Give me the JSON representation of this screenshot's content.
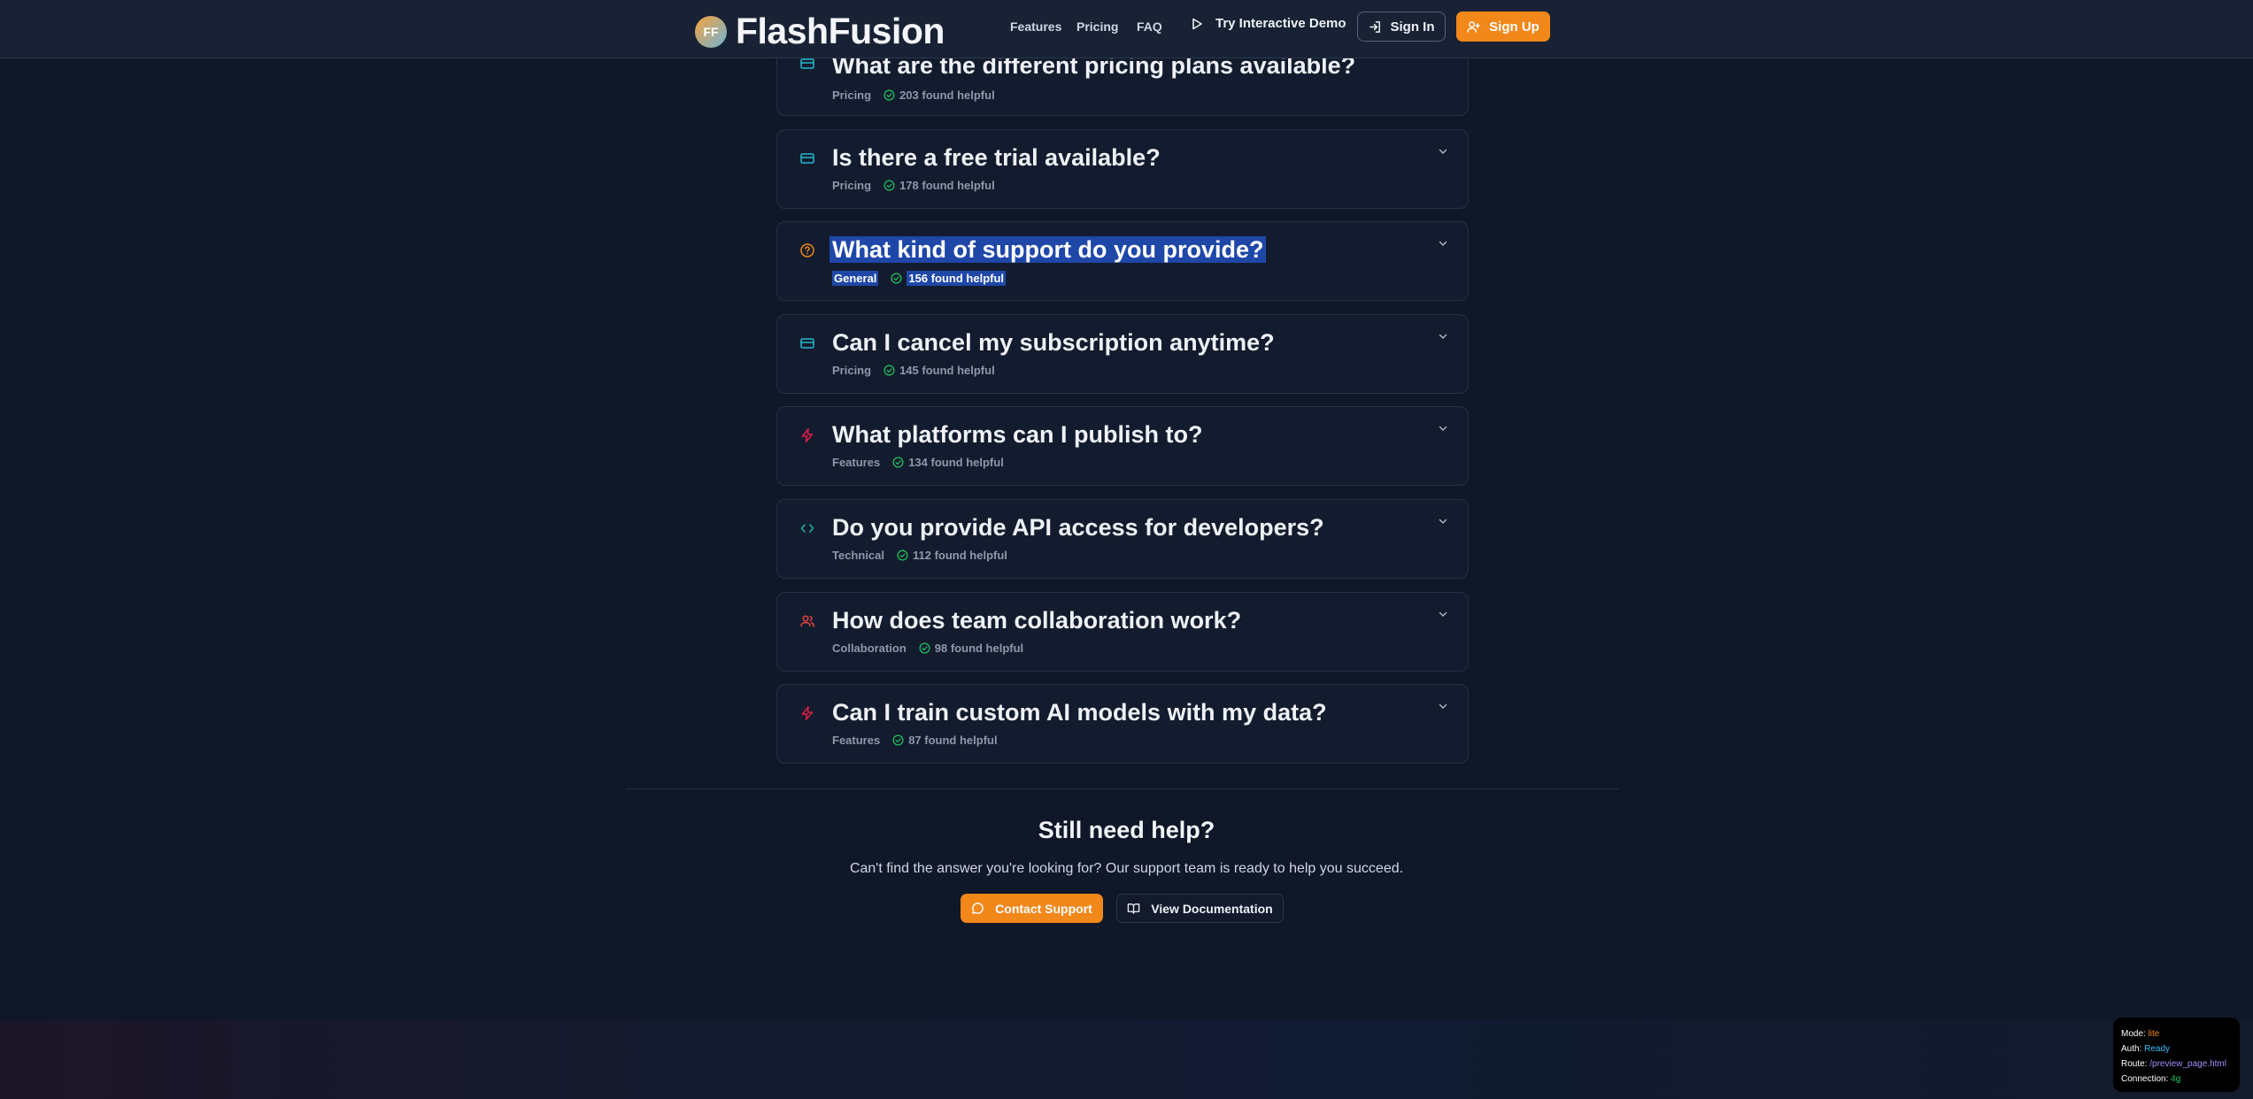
{
  "header": {
    "logo_initials": "FF",
    "brand": "FlashFusion",
    "nav": [
      "Features",
      "Pricing",
      "FAQ"
    ],
    "demo_label": "Try Interactive Demo",
    "signin_label": "Sign In",
    "signup_label": "Sign Up"
  },
  "faqs": [
    {
      "question": "What are the different pricing plans available?",
      "category": "Pricing",
      "helpful": "203 found helpful",
      "icon": "credit-card-icon"
    },
    {
      "question": "Is there a free trial available?",
      "category": "Pricing",
      "helpful": "178 found helpful",
      "icon": "credit-card-icon"
    },
    {
      "question": "What kind of support do you provide?",
      "category": "General",
      "helpful": "156 found helpful",
      "icon": "help-circle-icon"
    },
    {
      "question": "Can I cancel my subscription anytime?",
      "category": "Pricing",
      "helpful": "145 found helpful",
      "icon": "credit-card-icon"
    },
    {
      "question": "What platforms can I publish to?",
      "category": "Features",
      "helpful": "134 found helpful",
      "icon": "lightning-icon"
    },
    {
      "question": "Do you provide API access for developers?",
      "category": "Technical",
      "helpful": "112 found helpful",
      "icon": "code-icon"
    },
    {
      "question": "How does team collaboration work?",
      "category": "Collaboration",
      "helpful": "98 found helpful",
      "icon": "users-icon"
    },
    {
      "question": "Can I train custom AI models with my data?",
      "category": "Features",
      "helpful": "87 found helpful",
      "icon": "lightning-icon"
    }
  ],
  "help": {
    "title": "Still need help?",
    "subtitle": "Can't find the answer you're looking for? Our support team is ready to help you succeed.",
    "contact_label": "Contact Support",
    "docs_label": "View Documentation"
  },
  "status": {
    "mode_label": "Mode:",
    "mode_value": "lite",
    "auth_label": "Auth:",
    "auth_value": "Ready",
    "route_label": "Route:",
    "route_value": "/preview_page.html",
    "connection_label": "Connection:",
    "connection_value": "4g"
  },
  "colors": {
    "accent": "#f2871a",
    "background": "#0f1729",
    "pricing_icon": "#22b8cf",
    "general_icon": "#f2871a",
    "features_icon": "#e11d48",
    "technical_icon": "#14b8a6",
    "collaboration_icon": "#ef4444",
    "check": "#22c55e",
    "selection": "#1e47a8"
  }
}
